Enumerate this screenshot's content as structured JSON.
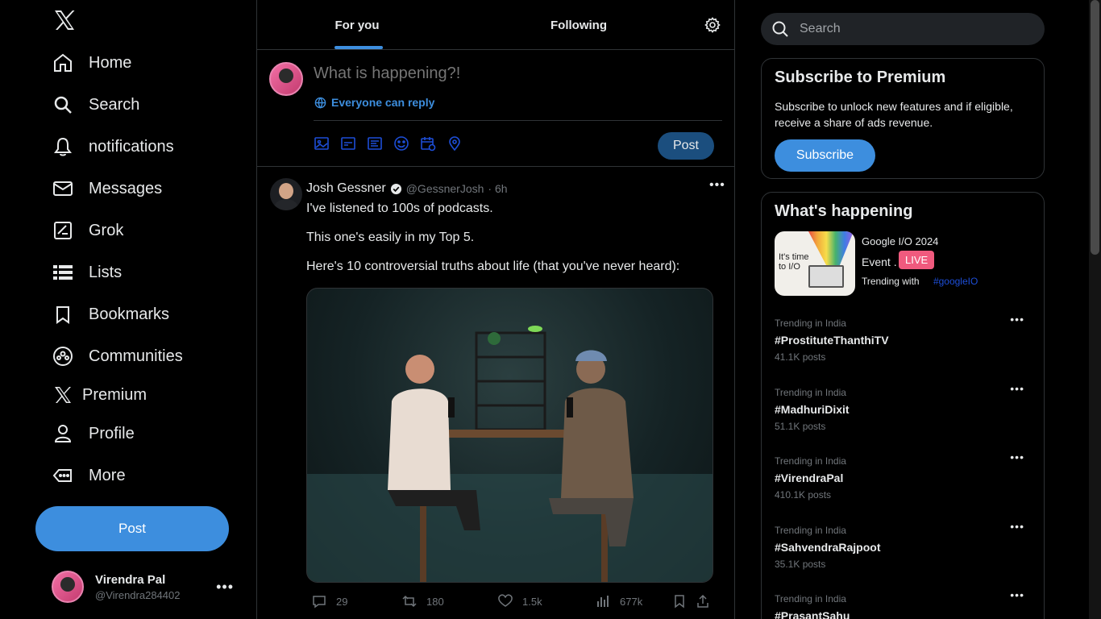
{
  "nav": {
    "items": [
      {
        "label": "Home",
        "icon": "home-icon"
      },
      {
        "label": "Search",
        "icon": "search-icon"
      },
      {
        "label": "notifications",
        "icon": "bell-icon"
      },
      {
        "label": "Messages",
        "icon": "envelope-icon"
      },
      {
        "label": "Grok",
        "icon": "grok-icon"
      },
      {
        "label": "Lists",
        "icon": "list-icon"
      },
      {
        "label": "Bookmarks",
        "icon": "bookmark-icon"
      },
      {
        "label": "Communities",
        "icon": "communities-icon"
      },
      {
        "label": "Premium",
        "icon": "x-logo-icon"
      },
      {
        "label": "Profile",
        "icon": "person-icon"
      },
      {
        "label": "More",
        "icon": "more-circle-icon"
      }
    ],
    "post_label": "Post"
  },
  "account": {
    "name": "Virendra Pal",
    "handle": "@Virendra284402"
  },
  "tabs": {
    "for_you": "For you",
    "following": "Following"
  },
  "composer": {
    "placeholder": "What is happening?!",
    "reply_setting": "Everyone can reply",
    "post_label": "Post"
  },
  "tweet": {
    "author": "Josh Gessner",
    "handle": "@GessnerJosh",
    "time": "· 6h",
    "lines": [
      "I've listened to 100s of podcasts.",
      "This one's easily in my Top 5.",
      "Here's 10 controversial truths about life (that you've never heard):"
    ],
    "replies": "29",
    "reposts": "180",
    "likes": "1.5k",
    "views": "677k"
  },
  "search": {
    "placeholder": "Search"
  },
  "premium": {
    "title": "Subscribe to Premium",
    "description": "Subscribe to unlock new features and if eligible, receive a share of ads revenue.",
    "button": "Subscribe"
  },
  "happening": {
    "title": "What's happening",
    "event": {
      "name": "Google I/O 2024",
      "type": "Event .",
      "live": "LIVE",
      "trending_with": "Trending with",
      "tag": "#googleIO",
      "image_text": "It's time to I/O"
    },
    "trends": [
      {
        "context": "Trending in India",
        "tag": "#ProstituteThanthiTV",
        "count": "41.1K posts"
      },
      {
        "context": "Trending in India",
        "tag": "#MadhuriDixit",
        "count": "51.1K posts"
      },
      {
        "context": "Trending in India",
        "tag": "#VirendraPal",
        "count": "410.1K posts"
      },
      {
        "context": "Trending in India",
        "tag": "#SahvendraRajpoot",
        "count": "35.1K posts"
      },
      {
        "context": "Trending in India",
        "tag": "#PrasantSahu",
        "count": ""
      }
    ]
  },
  "colors": {
    "accent": "#3d8ede",
    "background": "#000000",
    "border": "#2f3336",
    "live": "#f05a7e"
  }
}
